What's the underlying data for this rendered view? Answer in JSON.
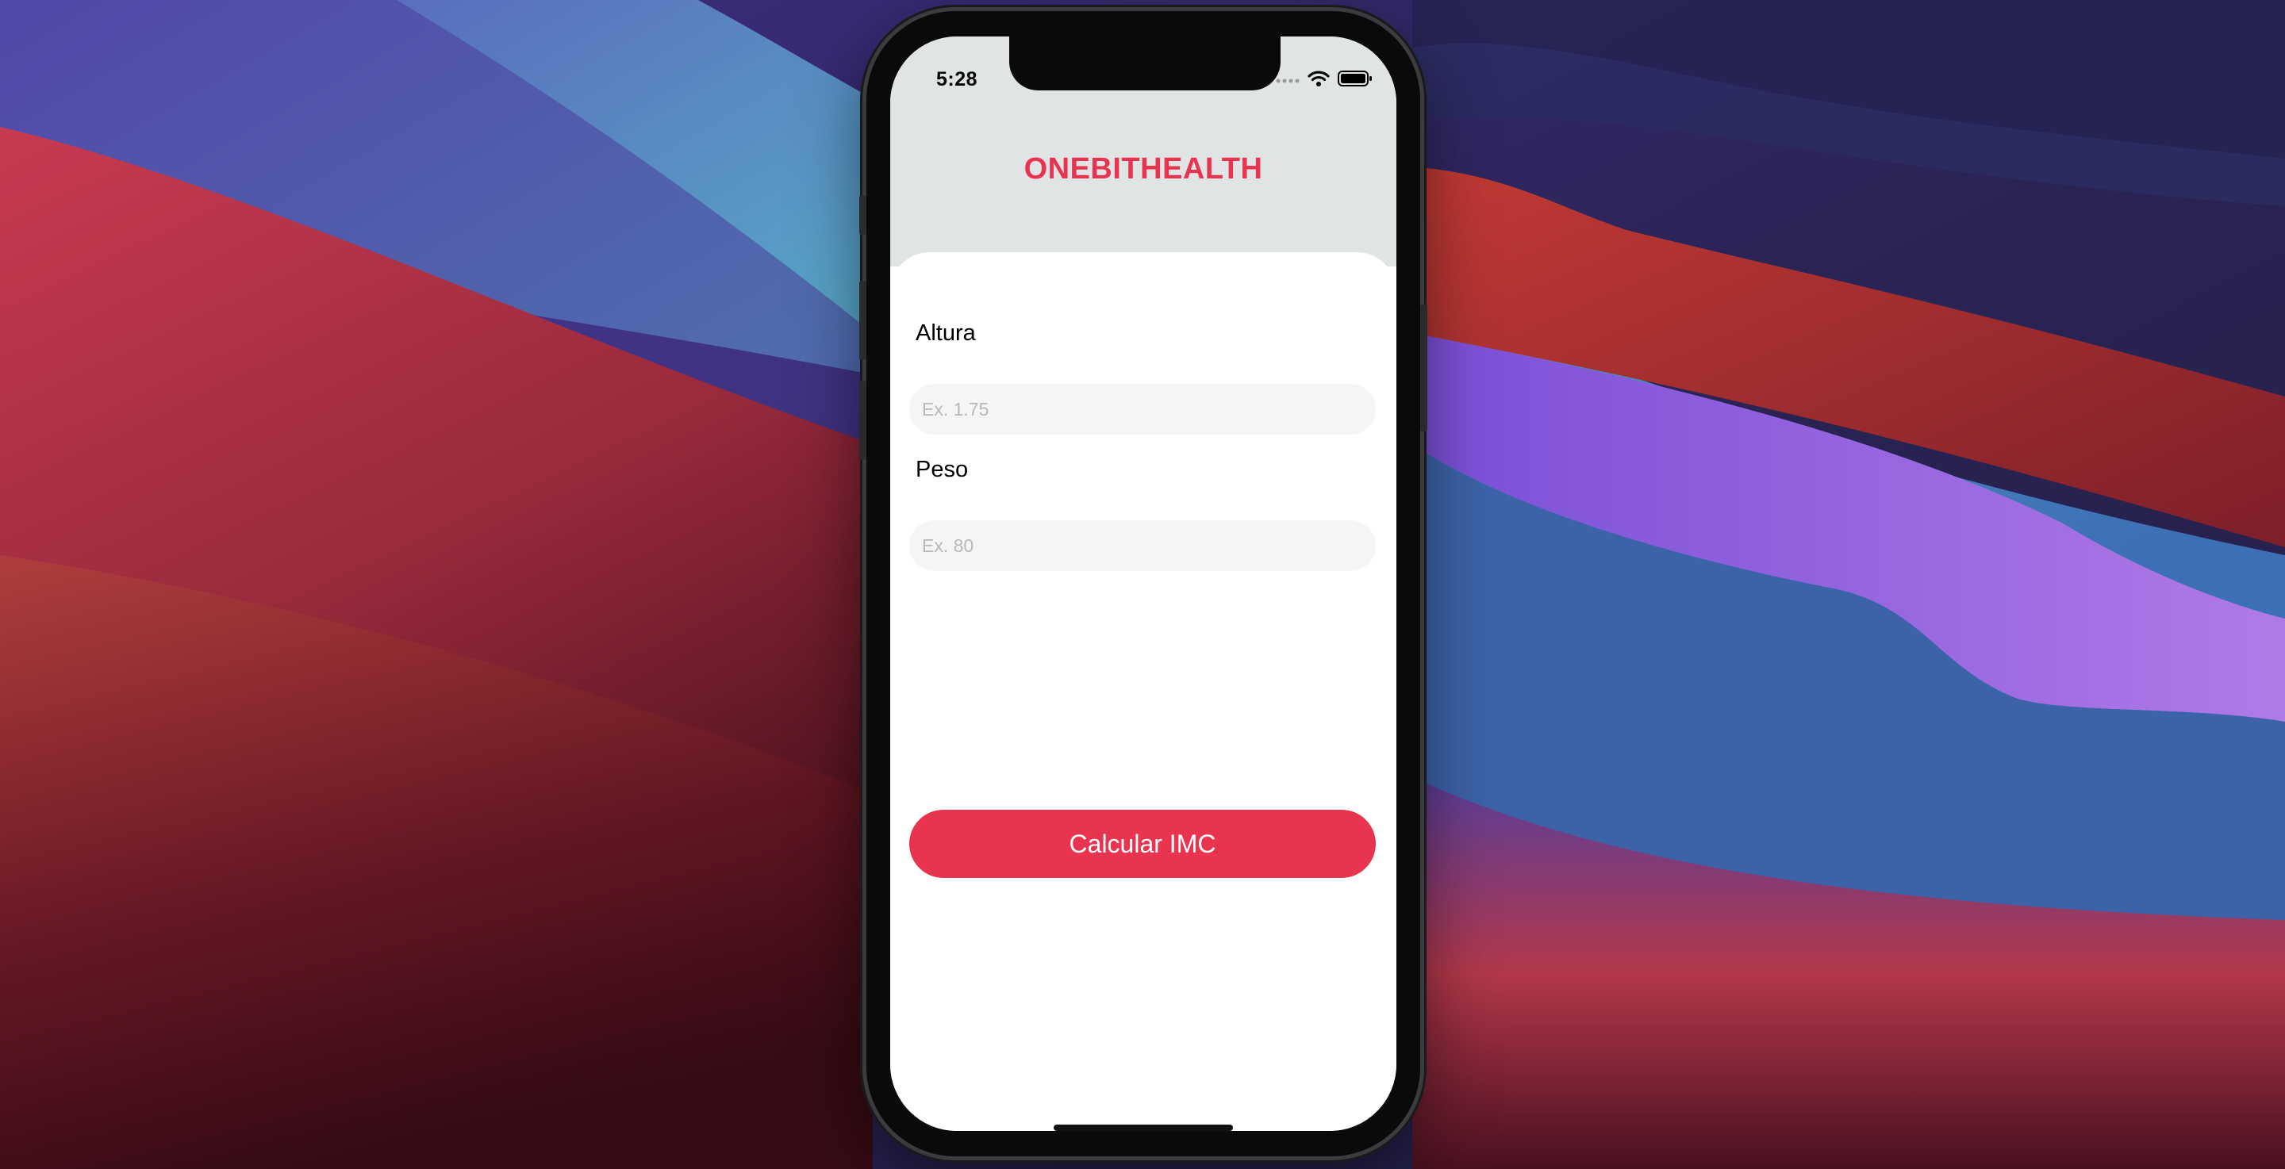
{
  "status_bar": {
    "time": "5:28",
    "icons": [
      "cellular-dots-icon",
      "wifi-icon",
      "battery-icon"
    ]
  },
  "app": {
    "title": "ONEBITHEALTH",
    "accent_color": "#e8344e",
    "header_background": "#e1e4e5"
  },
  "form": {
    "height_label": "Altura",
    "height_placeholder": "Ex. 1.75",
    "height_value": "",
    "weight_label": "Peso",
    "weight_placeholder": "Ex. 80",
    "weight_value": "",
    "submit_label": "Calcular IMC"
  }
}
